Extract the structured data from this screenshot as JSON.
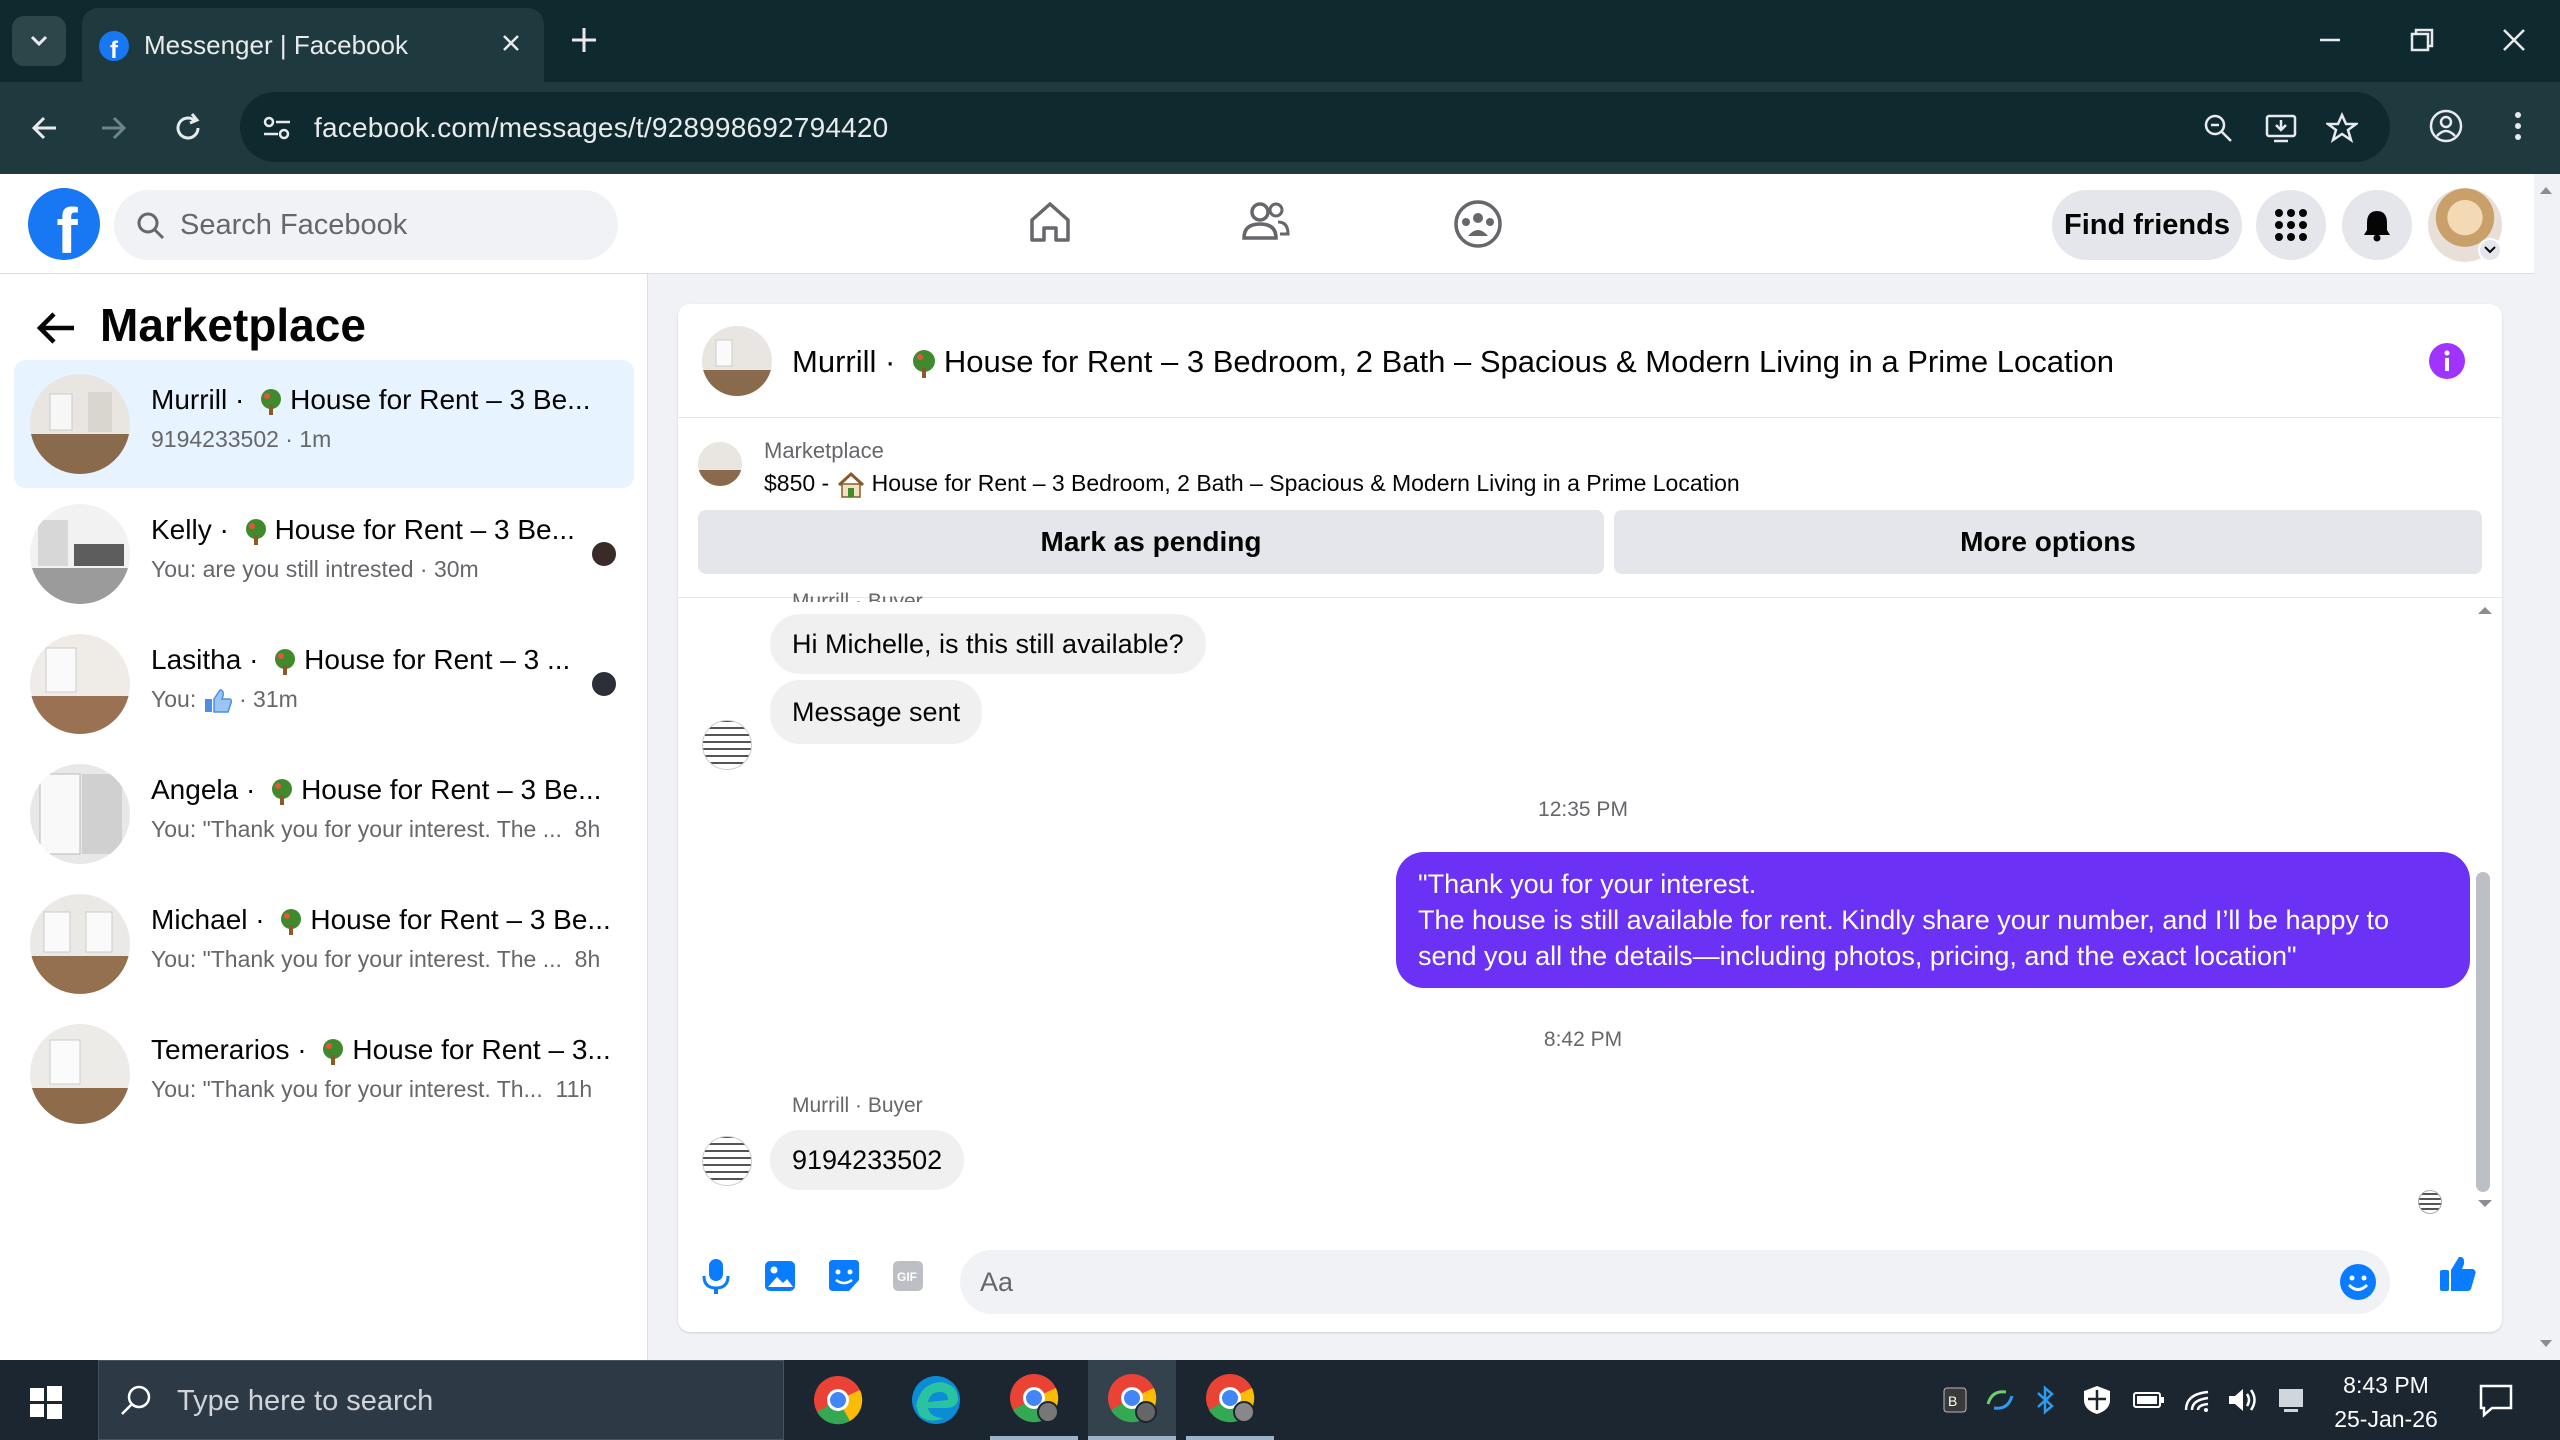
{
  "browser": {
    "tab_title": "Messenger | Facebook",
    "url": "facebook.com/messages/t/928998692794420"
  },
  "fb": {
    "search_placeholder": "Search Facebook",
    "find_friends": "Find friends"
  },
  "sidebar": {
    "title": "Marketplace",
    "conversations": [
      {
        "name": "Murrill · ",
        "listing": "House for Rent – 3 Be...",
        "sub": "9194233502 · 1m",
        "active": true
      },
      {
        "name": "Kelly · ",
        "listing": "House for Rent – 3 Be...",
        "sub": "You: are you still intrested · 30m"
      },
      {
        "name": "Lasitha · ",
        "listing": "House for Rent – 3 ...",
        "sub_prefix": "You: ",
        "sub_time": " · 31m"
      },
      {
        "name": "Angela · ",
        "listing": "House for Rent – 3 Be...",
        "sub": "You: \"Thank you for your interest. The ...",
        "time": "8h"
      },
      {
        "name": "Michael · ",
        "listing": "House for Rent – 3 Be...",
        "sub": "You: \"Thank you for your interest. The ...",
        "time": "8h"
      },
      {
        "name": "Temerarios · ",
        "listing": "House for Rent – 3...",
        "sub": "You: \"Thank you for your interest. Th...",
        "time": "11h"
      }
    ]
  },
  "chat": {
    "header_name": "Murrill · ",
    "header_listing": "House for Rent – 3 Bedroom, 2 Bath – Spacious & Modern Living in a Prime Location",
    "listing_source": "Marketplace",
    "listing_price": "$850 - ",
    "listing_title": "House for Rent – 3 Bedroom, 2 Bath – Spacious & Modern Living in a Prime Location",
    "mark_pending": "Mark as pending",
    "more_options": "More options",
    "sender_top": "Murrill · Buyer",
    "msg1": "Hi Michelle, is this still available?",
    "msg2": "Message sent",
    "time1": "12:35 PM",
    "out_lines": [
      "\"Thank you for your interest.",
      "The house is still available for rent. Kindly share your number, and I’ll be happy to",
      "send you all the details—including photos, pricing, and the exact location\""
    ],
    "time2": "8:42 PM",
    "sender_bottom": "Murrill · Buyer",
    "msg3": "9194233502",
    "composer_placeholder": "Aa"
  },
  "taskbar": {
    "search_placeholder": "Type here to search",
    "time": "8:43 PM",
    "date": "25-Jan-26"
  },
  "colors": {
    "fb_blue": "#1877f2",
    "outgoing_bubble": "#6b31f5",
    "info_icon": "#a033ff"
  }
}
